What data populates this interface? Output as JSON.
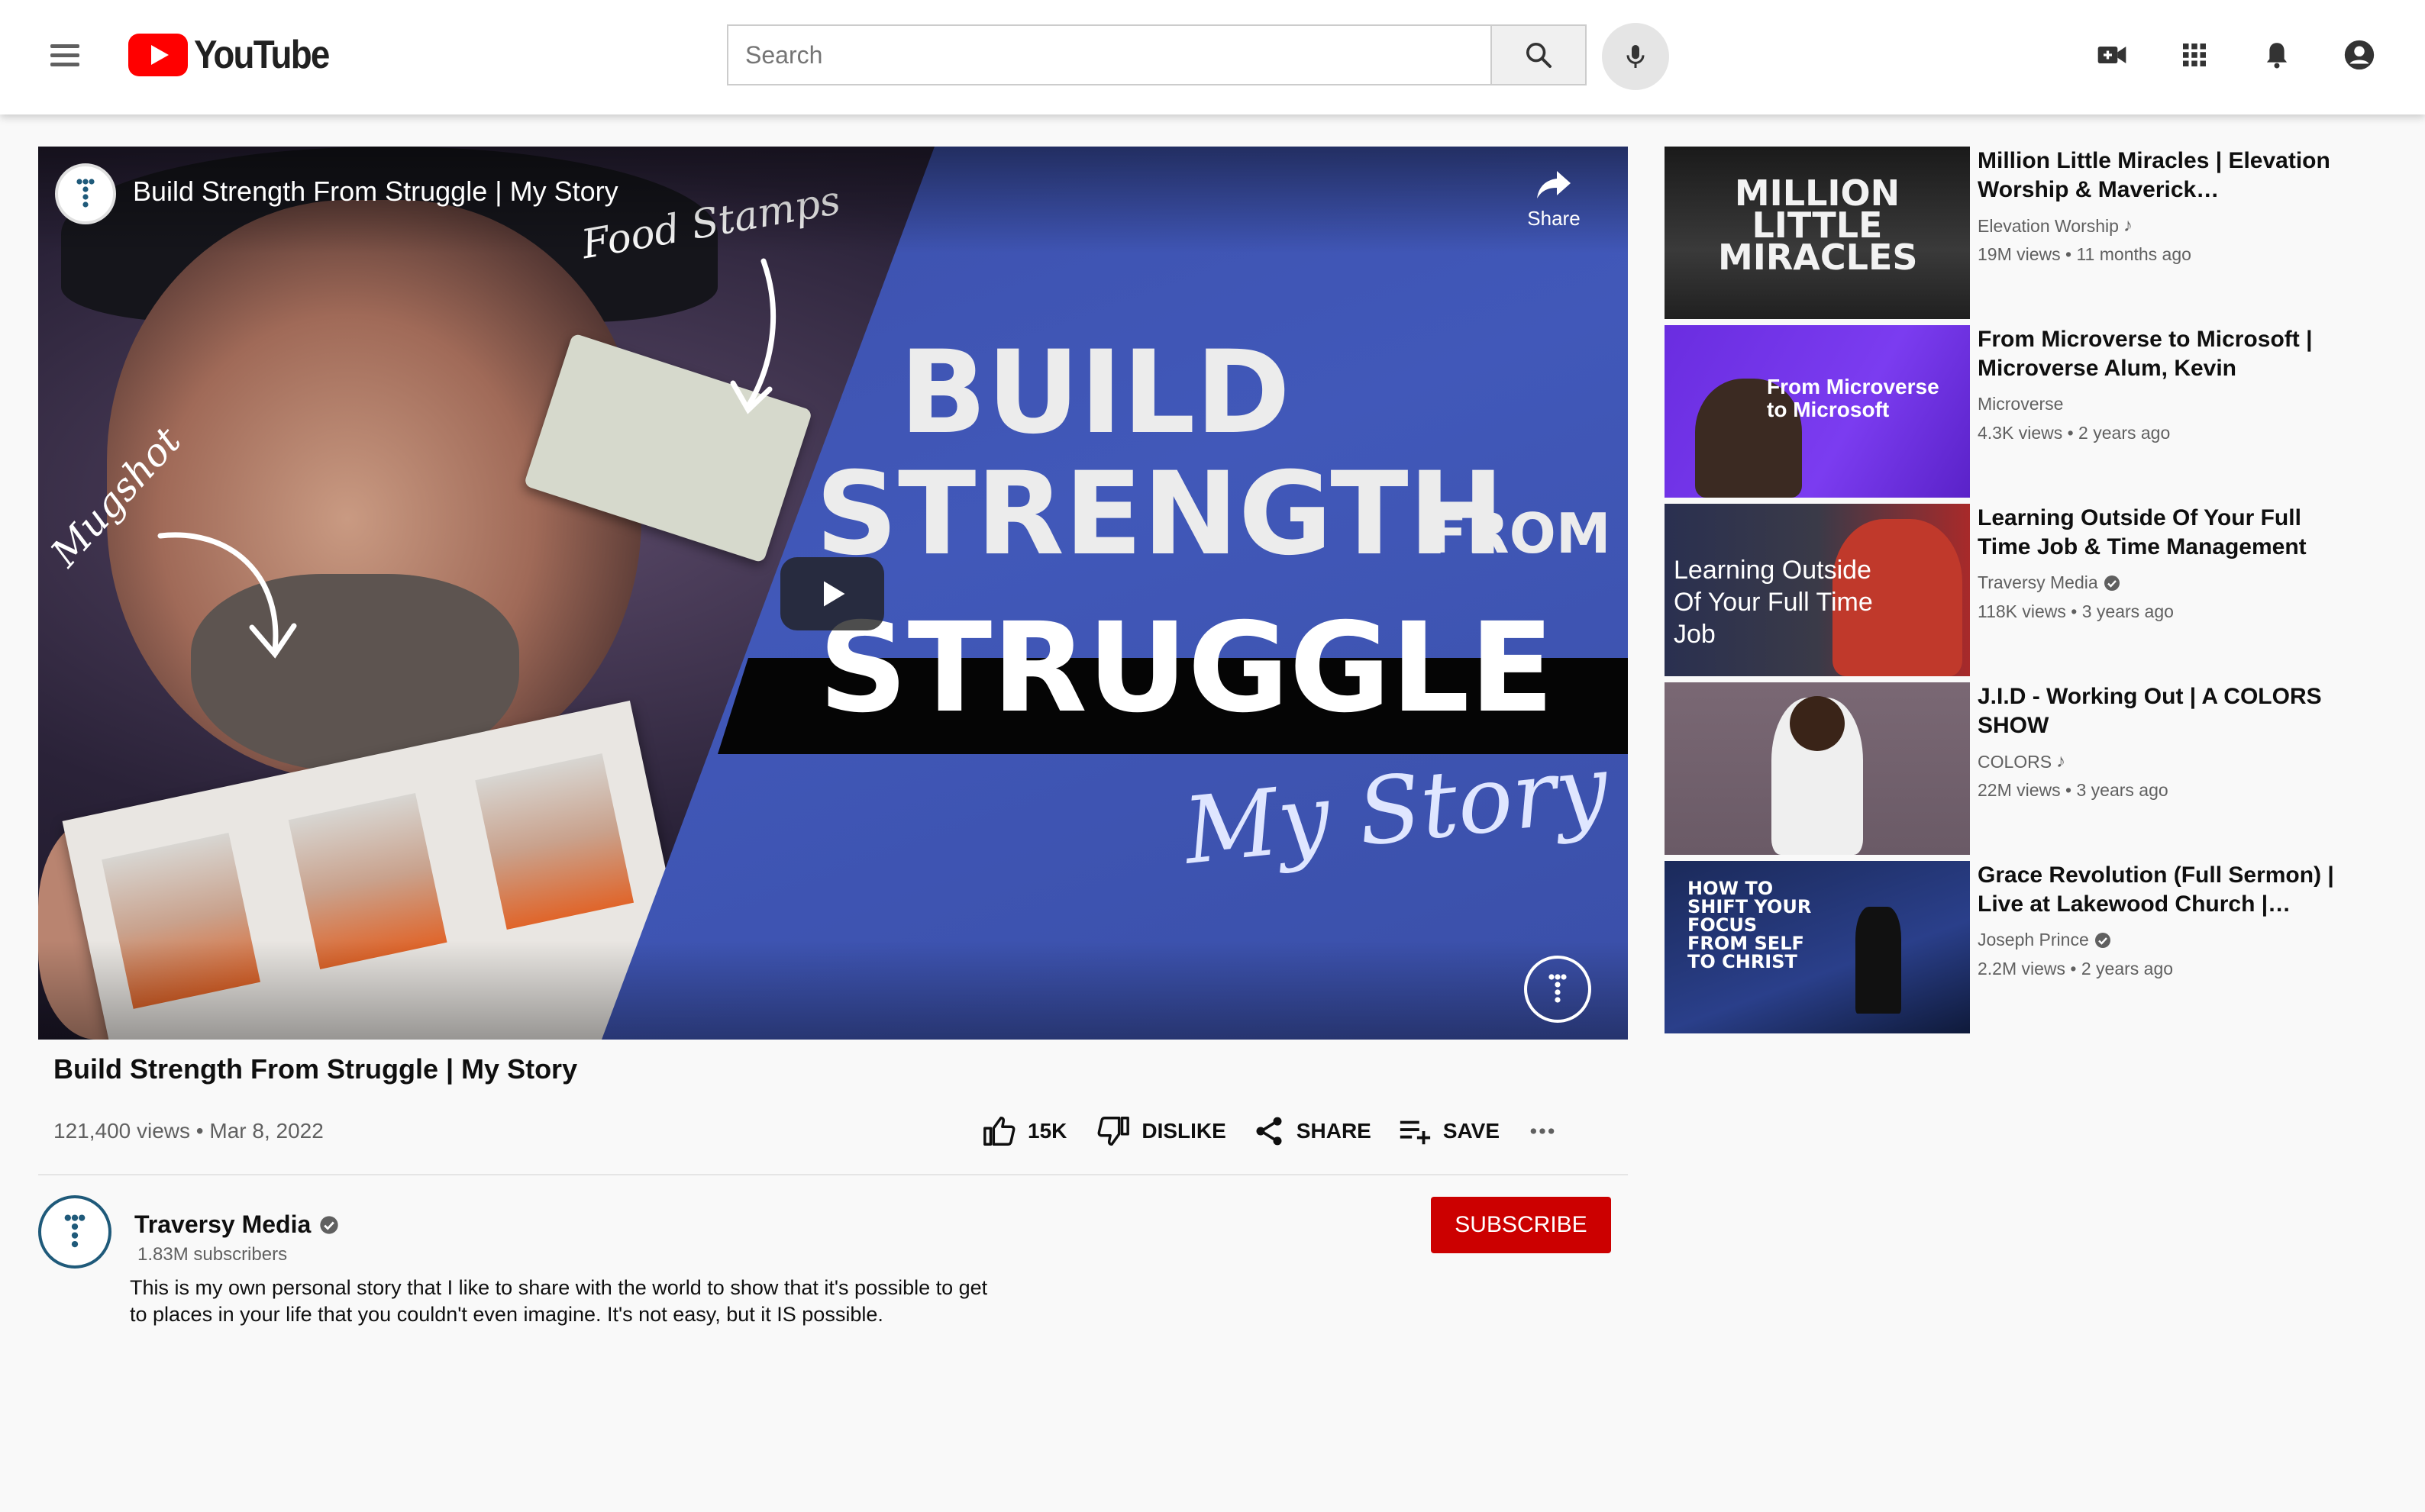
{
  "header": {
    "logo_text": "YouTube",
    "search_placeholder": "Search"
  },
  "player": {
    "title": "Build Strength From Struggle | My Story",
    "share_label": "Share",
    "thumbnail_text": {
      "food_stamps": "Food Stamps",
      "mugshot": "Mugshot",
      "line1": "BUILD",
      "line2": "STRENGTH",
      "from": "FROM",
      "line3": "STRUGGLE",
      "script": "My Story"
    }
  },
  "video": {
    "title": "Build Strength From Struggle | My Story",
    "meta": "121,400 views • Mar 8, 2022",
    "likes": "15K",
    "dislike_label": "DISLIKE",
    "share_label": "SHARE",
    "save_label": "SAVE"
  },
  "channel": {
    "name": "Traversy Media",
    "subscribers": "1.83M subscribers",
    "subscribe_label": "SUBSCRIBE",
    "description": "This is my own personal story that I like to share with the world to show that it's possible to get to places in your life that you couldn't even imagine. It's not easy, but it IS possible."
  },
  "recommendations": [
    {
      "title": "Million Little Miracles | Elevation Worship & Maverick…",
      "channel": "Elevation Worship",
      "badge": "music-note",
      "stats": "19M views • 11 months ago",
      "thumb_text": "MILLION LITTLE MIRACLES"
    },
    {
      "title": "From Microverse to Microsoft | Microverse Alum, Kevin",
      "channel": "Microverse",
      "badge": "none",
      "stats": "4.3K views • 2 years ago",
      "thumb_text": "From Microverse to Microsoft"
    },
    {
      "title": "Learning Outside Of Your Full Time Job & Time Management",
      "channel": "Traversy Media",
      "badge": "verified",
      "stats": "118K views • 3 years ago",
      "thumb_text": "Learning Outside Of Your Full Time Job"
    },
    {
      "title": "J.I.D - Working Out | A COLORS SHOW",
      "channel": "COLORS",
      "badge": "music-note",
      "stats": "22M views • 3 years ago",
      "thumb_text": ""
    },
    {
      "title": "Grace Revolution (Full Sermon) | Live at Lakewood Church |…",
      "channel": "Joseph Prince",
      "badge": "verified",
      "stats": "2.2M views • 2 years ago",
      "thumb_text": "HOW TO SHIFT YOUR FOCUS FROM SELF TO CHRIST"
    }
  ],
  "colors": {
    "brand_red": "#ff0000",
    "subscribe_red": "#cc0000",
    "thumbnail_blue": "#4158b9"
  }
}
